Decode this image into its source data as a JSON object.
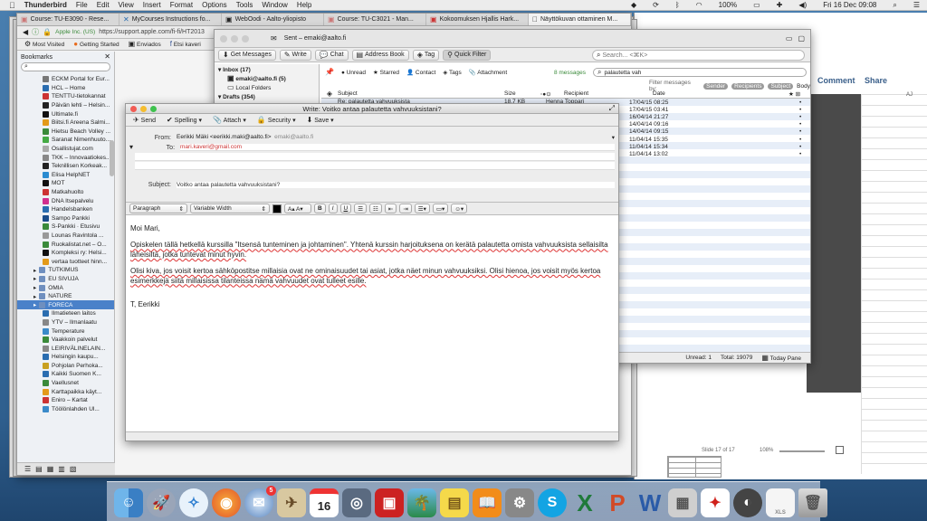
{
  "menubar": {
    "apple": "",
    "app": "Thunderbird",
    "items": [
      "File",
      "Edit",
      "View",
      "Insert",
      "Format",
      "Options",
      "Tools",
      "Window",
      "Help"
    ],
    "battery": "100%",
    "clock": "Fri 16 Dec  09:08"
  },
  "browser": {
    "tabs": [
      "Course: TU-E3090 - Rese...",
      "MyCourses Instructions fo...",
      "WebOodi - Aalto-yliopisto",
      "Course: TU-C3021 - Man...",
      "Kokoomuksen Hjallis Hark...",
      "Näyttökuvan ottaminen M..."
    ],
    "url_badge": "Apple Inc. (US)",
    "url": "https://support.apple.com/fi-fi/HT2013",
    "bookmark_bar": [
      "Most Visited",
      "Getting Started",
      "Enviados",
      "Etsi kaveri"
    ],
    "sidebar_title": "Bookmarks",
    "bookmarks": [
      {
        "t": "ECKM Portal for Eur...",
        "c": "#777",
        "f": false
      },
      {
        "t": "HCL – Home",
        "c": "#2a6db0",
        "f": false
      },
      {
        "t": "TENTTU-tietokannat",
        "c": "#c33",
        "f": false
      },
      {
        "t": "Päivän lehti – Helsin...",
        "c": "#222",
        "f": false
      },
      {
        "t": "Ultimate.fi",
        "c": "#111",
        "f": false
      },
      {
        "t": "Biitsi.fi Areena Salmi...",
        "c": "#e39a1a",
        "f": false
      },
      {
        "t": "Hietsu Beach Volley ...",
        "c": "#3a8a3a",
        "f": false
      },
      {
        "t": "Saranat Nimenhuuto...",
        "c": "#4a4",
        "f": false
      },
      {
        "t": "Osallistujat.com",
        "c": "#aaa",
        "f": false
      },
      {
        "t": "TKK – Innovaatiokes...",
        "c": "#888",
        "f": false
      },
      {
        "t": "Teknillisen Korkeak...",
        "c": "#222",
        "f": false
      },
      {
        "t": "Elisa HelpNET",
        "c": "#2a8bd0",
        "f": false
      },
      {
        "t": "MOT",
        "c": "#111",
        "f": false
      },
      {
        "t": "Matkahuolto",
        "c": "#c33",
        "f": false
      },
      {
        "t": "DNA Itsepalvelu",
        "c": "#d22f8e",
        "f": false
      },
      {
        "t": "Handelsbanken",
        "c": "#2a6db0",
        "f": false
      },
      {
        "t": "Sampo Pankki",
        "c": "#1a4c8a",
        "f": false
      },
      {
        "t": "S-Pankki · Etusivu",
        "c": "#3a8a3a",
        "f": false
      },
      {
        "t": "Lounas Ravintola ...",
        "c": "#999",
        "f": false
      },
      {
        "t": "Ruokalistat.net – O...",
        "c": "#3a8a3a",
        "f": false
      },
      {
        "t": "Kompleksi ry: Helsi...",
        "c": "#111",
        "f": false
      },
      {
        "t": "vertaa tuotteet hinn...",
        "c": "#e39a1a",
        "f": false
      },
      {
        "t": "TUTKIMUS",
        "c": "#6f8fbf",
        "f": true
      },
      {
        "t": "EU SIVUJA",
        "c": "#6f8fbf",
        "f": true
      },
      {
        "t": "OMIA",
        "c": "#6f8fbf",
        "f": true
      },
      {
        "t": "NATURE",
        "c": "#6f8fbf",
        "f": true
      },
      {
        "t": "FORECA",
        "c": "#6f8fbf",
        "f": true,
        "sel": true
      },
      {
        "t": "Ilmatieteen laitos",
        "c": "#2a6db0",
        "f": false
      },
      {
        "t": "YTV – Ilmanlaatu",
        "c": "#888",
        "f": false
      },
      {
        "t": "Temperature",
        "c": "#3a8ac9",
        "f": false
      },
      {
        "t": "Vaakkoin palvelut",
        "c": "#3a8a3a",
        "f": false
      },
      {
        "t": "LEIRIVÄLINELAIN...",
        "c": "#888",
        "f": false
      },
      {
        "t": "Helsingin kaupu...",
        "c": "#2a6db0",
        "f": false
      },
      {
        "t": "Pohjolan Perhoka...",
        "c": "#c8a020",
        "f": false
      },
      {
        "t": "Kaikki Suomen K...",
        "c": "#2a6db0",
        "f": false
      },
      {
        "t": "Vaellusnet",
        "c": "#3a8a3a",
        "f": false
      },
      {
        "t": "Karttapaikka käyt...",
        "c": "#e39a1a",
        "f": false
      },
      {
        "t": "Eniro – Kartat",
        "c": "#c33",
        "f": false
      },
      {
        "t": "Töölönlahden Ul...",
        "c": "#3a8ac9",
        "f": false
      }
    ]
  },
  "mail": {
    "title": "Sent – emaki@aalto.fi",
    "toolbar": [
      "Get Messages",
      "Write",
      "Chat",
      "Address Book",
      "Tag",
      "Quick Filter"
    ],
    "search_placeholder": "Search... <⌘K>",
    "folders": [
      "Inbox (17)",
      "emaki@aalto.fi (5)",
      "Local Folders",
      "Drafts (354)"
    ],
    "filterbar": [
      "Unread",
      "Starred",
      "Contact",
      "Tags",
      "Attachment"
    ],
    "msg_count": "8 messages",
    "filter_text": "palautetta vah",
    "filter_by": "Filter messages by:",
    "filter_btns": [
      "Sender",
      "Recipients",
      "Subject",
      "Body"
    ],
    "cols": {
      "subject": "Subject",
      "size": "Size",
      "recipient": "Recipient",
      "date": "Date"
    },
    "first_row": {
      "subject": "Re: palautetta vahvuuksista",
      "size": "18.7 KB",
      "recipient": "Henna Toppari"
    },
    "dates": [
      "17/04/15 08:25",
      "17/04/15 03:41",
      "16/04/14 21:27",
      "14/04/14 09:16",
      "14/04/14 09:15",
      "11/04/14 15:35",
      "11/04/14 15:34",
      "11/04/14 13:02"
    ],
    "status": {
      "unread": "Unread: 1",
      "total": "Total: 19079",
      "today": "Today Pane"
    }
  },
  "compose": {
    "title": "Write: Voitko antaa palautetta vahvuuksistani?",
    "toolbar": [
      "Send",
      "Spelling",
      "Attach",
      "Security",
      "Save"
    ],
    "from_label": "From:",
    "from": "Eerikki Mäki <eerikki.maki@aalto.fi>",
    "from_extra": "emaki@aalto.fi",
    "to_label": "To:",
    "to": "mari.kaveri@gmail.com",
    "subject_label": "Subject:",
    "subject": "Voitko antaa palautetta vahvuuksistani?",
    "format": {
      "para": "Paragraph",
      "font": "Variable Width"
    },
    "greeting": "Moi Mari,",
    "p1": "Opiskelen tällä hetkellä kurssilla \"Itsensä tunteminen ja johtaminen\". Yhtenä kurssin harjoituksena on kerätä palautetta omista vahvuuksista sellaisilta läheisiltä, jotka tuntevat minut hyvin.",
    "p2": "Olisi kiva, jos voisit kertoa sähköpostitse millaisia ovat ne ominaisuudet tai asiat, jotka näet minun vahvuuksiksi. Olisi hienoa, jos voisit myös kertoa esimerkkejä siitä millaisissa tilanteissa nämä vahvuudet ovat tulleet esille.",
    "sign": "T, Eerikki"
  },
  "right": {
    "comment": "Comment",
    "share": "Share",
    "col": "AJ",
    "slide": "Slide 17 of 17",
    "zoom": "108%"
  },
  "dock": {
    "calendar_day": "16",
    "mail_badge": "5",
    "xls": "XLS"
  }
}
